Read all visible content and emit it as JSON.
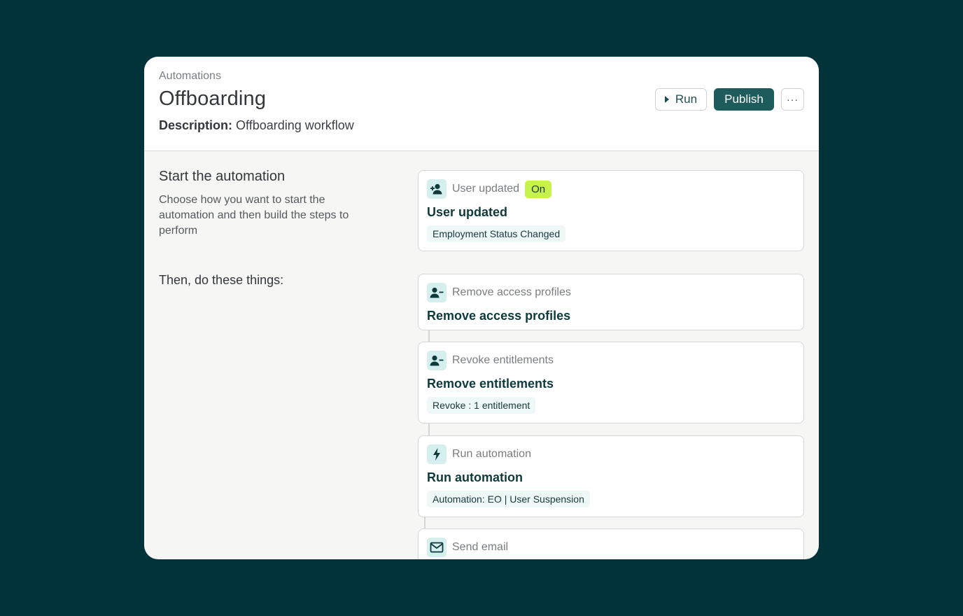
{
  "header": {
    "breadcrumb": "Automations",
    "title": "Offboarding",
    "description_label": "Description:",
    "description_value": "Offboarding workflow"
  },
  "toolbar": {
    "run_label": "Run",
    "publish_label": "Publish",
    "more_label": "···"
  },
  "start": {
    "title": "Start the automation",
    "description": "Choose how you want to start the automation and then build the steps to perform"
  },
  "then_label": "Then, do these things:",
  "trigger": {
    "icon": "user-add-icon",
    "kind": "User updated",
    "badge": "On",
    "title": "User updated",
    "tag": "Employment Status Changed"
  },
  "steps": [
    {
      "icon": "user-remove-icon",
      "kind": "Remove access profiles",
      "title": "Remove access profiles"
    },
    {
      "icon": "user-remove-icon",
      "kind": "Revoke entitlements",
      "title": "Remove entitlements",
      "tag": "Revoke : 1 entitlement"
    },
    {
      "icon": "lightning-icon",
      "kind": "Run automation",
      "title": "Run automation",
      "tag": "Automation: EO | User Suspension"
    },
    {
      "icon": "mail-icon",
      "kind": "Send email"
    }
  ],
  "colors": {
    "background": "#01343a",
    "primary": "#1e5b5c",
    "badge_on": "#c6f24b",
    "icon_bg": "#d5efee"
  }
}
